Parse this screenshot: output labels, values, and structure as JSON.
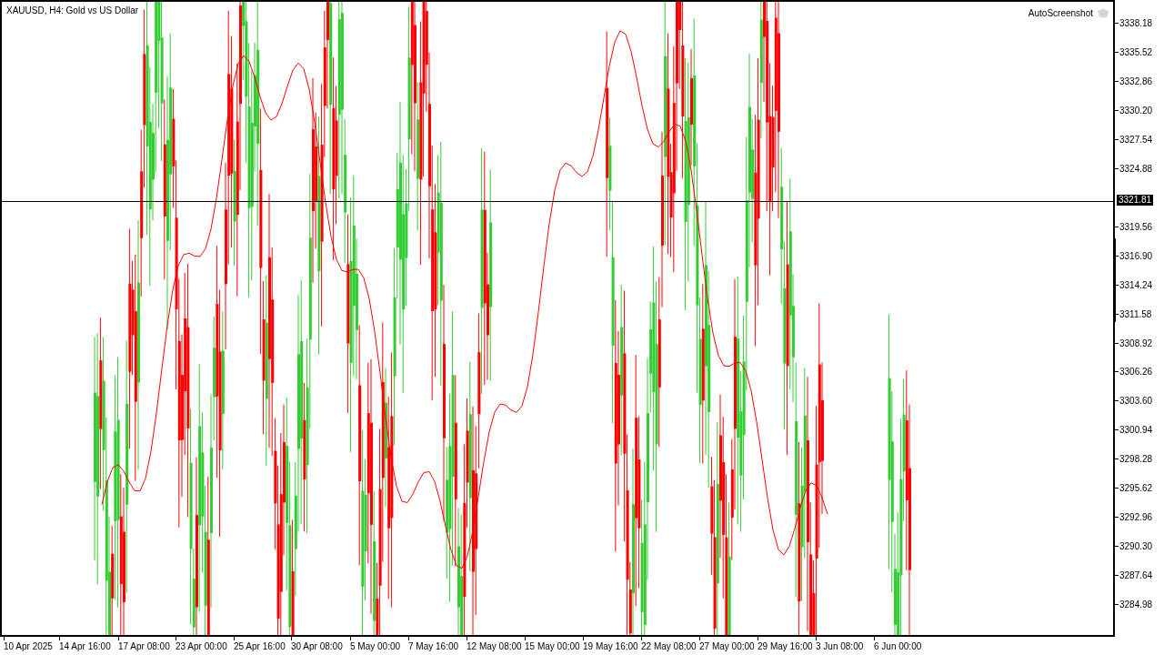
{
  "chart": {
    "title": "XAUUSD, H4:  Gold vs US Dollar",
    "indicator_label": "AutoScreenshot"
  },
  "price_axis": {
    "labels_above": [
      "3338.18",
      "3335.52",
      "3332.86",
      "3330.20",
      "3327.54",
      "3324.88"
    ],
    "labels_below": [
      "3319.56",
      "3316.90",
      "3314.24",
      "3311.58",
      "3308.92",
      "3306.26",
      "3303.60",
      "3300.94",
      "3298.28",
      "3295.62",
      "3292.96",
      "3290.30",
      "3287.64",
      "3284.98"
    ],
    "current_price": "3321.81"
  },
  "time_axis": {
    "labels": [
      "10 Apr 2025",
      "14 Apr 16:00",
      "17 Apr 08:00",
      "23 Apr 00:00",
      "25 Apr 16:00",
      "30 Apr 08:00",
      "5 May 00:00",
      "7 May 16:00",
      "12 May 08:00",
      "15 May 00:00",
      "19 May 16:00",
      "22 May 08:00",
      "27 May 00:00",
      "29 May 16:00",
      "3 Jun 08:00",
      "6 Jun 00:00"
    ]
  }
}
